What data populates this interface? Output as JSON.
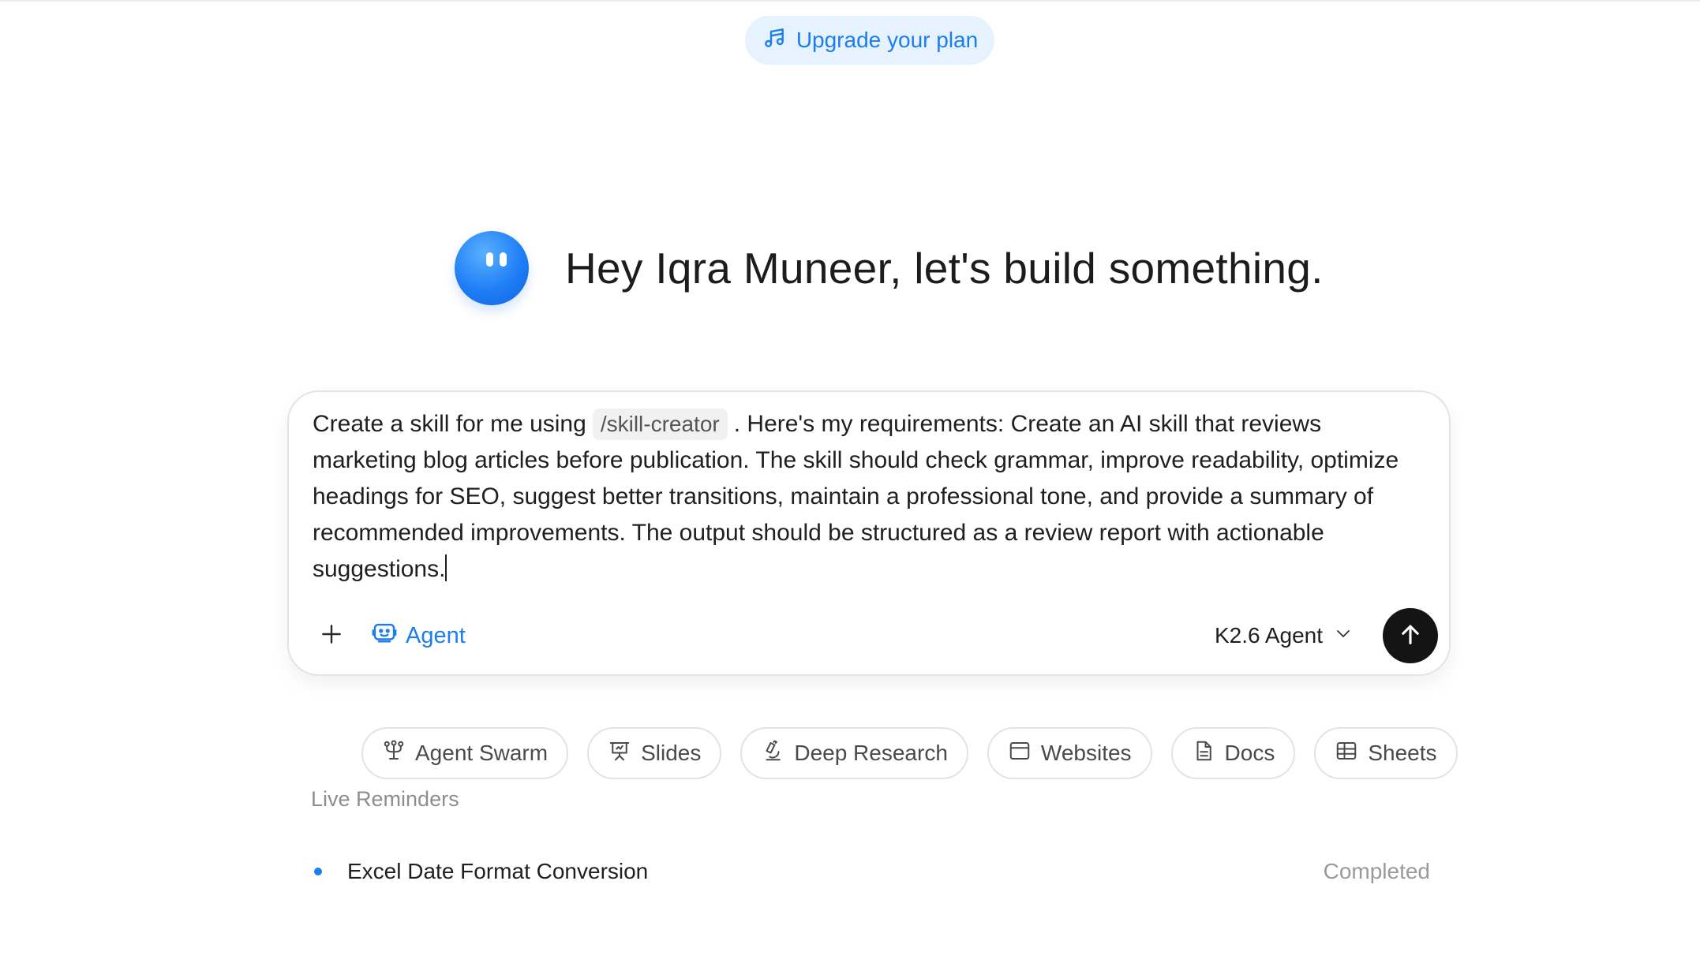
{
  "header": {
    "upgrade_label": "Upgrade your plan",
    "upgrade_icon": "music-notes-icon"
  },
  "greeting": {
    "text": "Hey Iqra Muneer, let's build something.",
    "avatar_icon": "mascot-avatar"
  },
  "composer": {
    "text_before": "Create a skill for me using",
    "command_chip": "/skill-creator",
    "text_after": ". Here's my requirements: Create an AI skill that reviews marketing blog articles before publication. The skill should check grammar, improve readability, optimize headings for SEO, suggest better transitions, maintain a professional tone, and provide a summary of recommended improvements. The output should be structured as a review report with actionable suggestions.",
    "agent_label": "Agent",
    "model_label": "K2.6 Agent"
  },
  "actions": [
    {
      "label": "Agent Swarm",
      "icon": "agent-swarm-icon"
    },
    {
      "label": "Slides",
      "icon": "slides-icon"
    },
    {
      "label": "Deep Research",
      "icon": "microscope-icon"
    },
    {
      "label": "Websites",
      "icon": "browser-window-icon"
    },
    {
      "label": "Docs",
      "icon": "document-icon"
    },
    {
      "label": "Sheets",
      "icon": "table-icon"
    }
  ],
  "reminders": {
    "label": "Live Reminders",
    "items": [
      {
        "title": "Excel Date Format Conversion",
        "status": "Completed"
      }
    ]
  },
  "colors": {
    "accent": "#1a7ef0",
    "upgrade_bg": "#e6f2fe",
    "send_bg": "#141414"
  }
}
